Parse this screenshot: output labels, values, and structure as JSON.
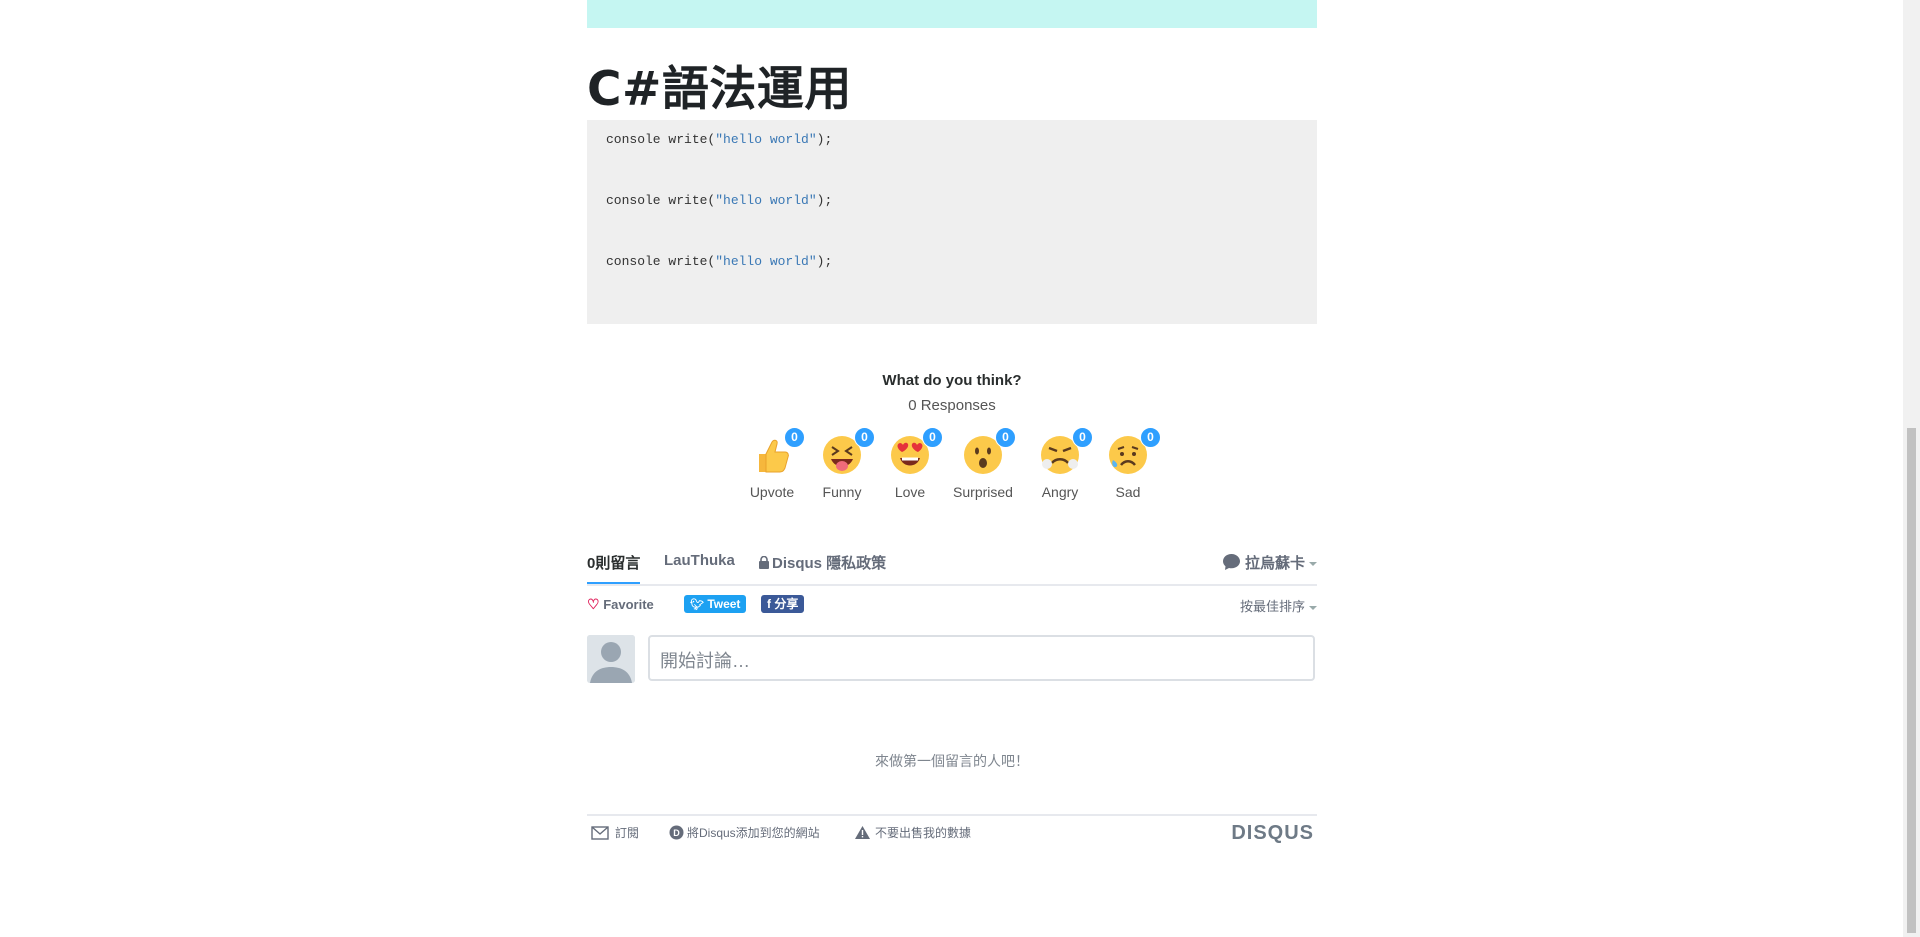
{
  "article": {
    "heading": "C#語法運用",
    "code_lines": [
      {
        "prefix": "console write(",
        "string": "\"hello world\"",
        "suffix": ");"
      },
      {
        "prefix": "console write(",
        "string": "\"hello world\"",
        "suffix": ");"
      },
      {
        "prefix": "console write(",
        "string": "\"hello world\"",
        "suffix": ");"
      }
    ]
  },
  "reactions": {
    "question": "What do you think?",
    "responses": "0 Responses",
    "items": [
      {
        "label": "Upvote",
        "count": "0",
        "icon": "thumbs-up-icon"
      },
      {
        "label": "Funny",
        "count": "0",
        "icon": "laughing-face-icon"
      },
      {
        "label": "Love",
        "count": "0",
        "icon": "heart-eyes-face-icon"
      },
      {
        "label": "Surprised",
        "count": "0",
        "icon": "surprised-face-icon"
      },
      {
        "label": "Angry",
        "count": "0",
        "icon": "angry-face-icon"
      },
      {
        "label": "Sad",
        "count": "0",
        "icon": "sad-face-icon"
      }
    ]
  },
  "comments": {
    "tabs": {
      "count_label": "0則留言",
      "site_label": "LauThuka",
      "privacy_label": "Disqus 隱私政策"
    },
    "user_menu_label": "拉烏蘇卡",
    "favorite_label": "Favorite",
    "tweet_label": "Tweet",
    "share_label": "分享",
    "sort_label": "按最佳排序",
    "input_placeholder": "開始討論…",
    "empty_message": "來做第一個留言的人吧！"
  },
  "footer": {
    "subscribe_label": "訂閱",
    "add_disqus_label": "將Disqus添加到您的網站",
    "do_not_sell_label": "不要出售我的數據",
    "brand": "DISQUS"
  },
  "colors": {
    "accent": "#2e9fff",
    "banner": "#c5f6f2",
    "tweet": "#1da1f2",
    "facebook": "#3b5998"
  }
}
